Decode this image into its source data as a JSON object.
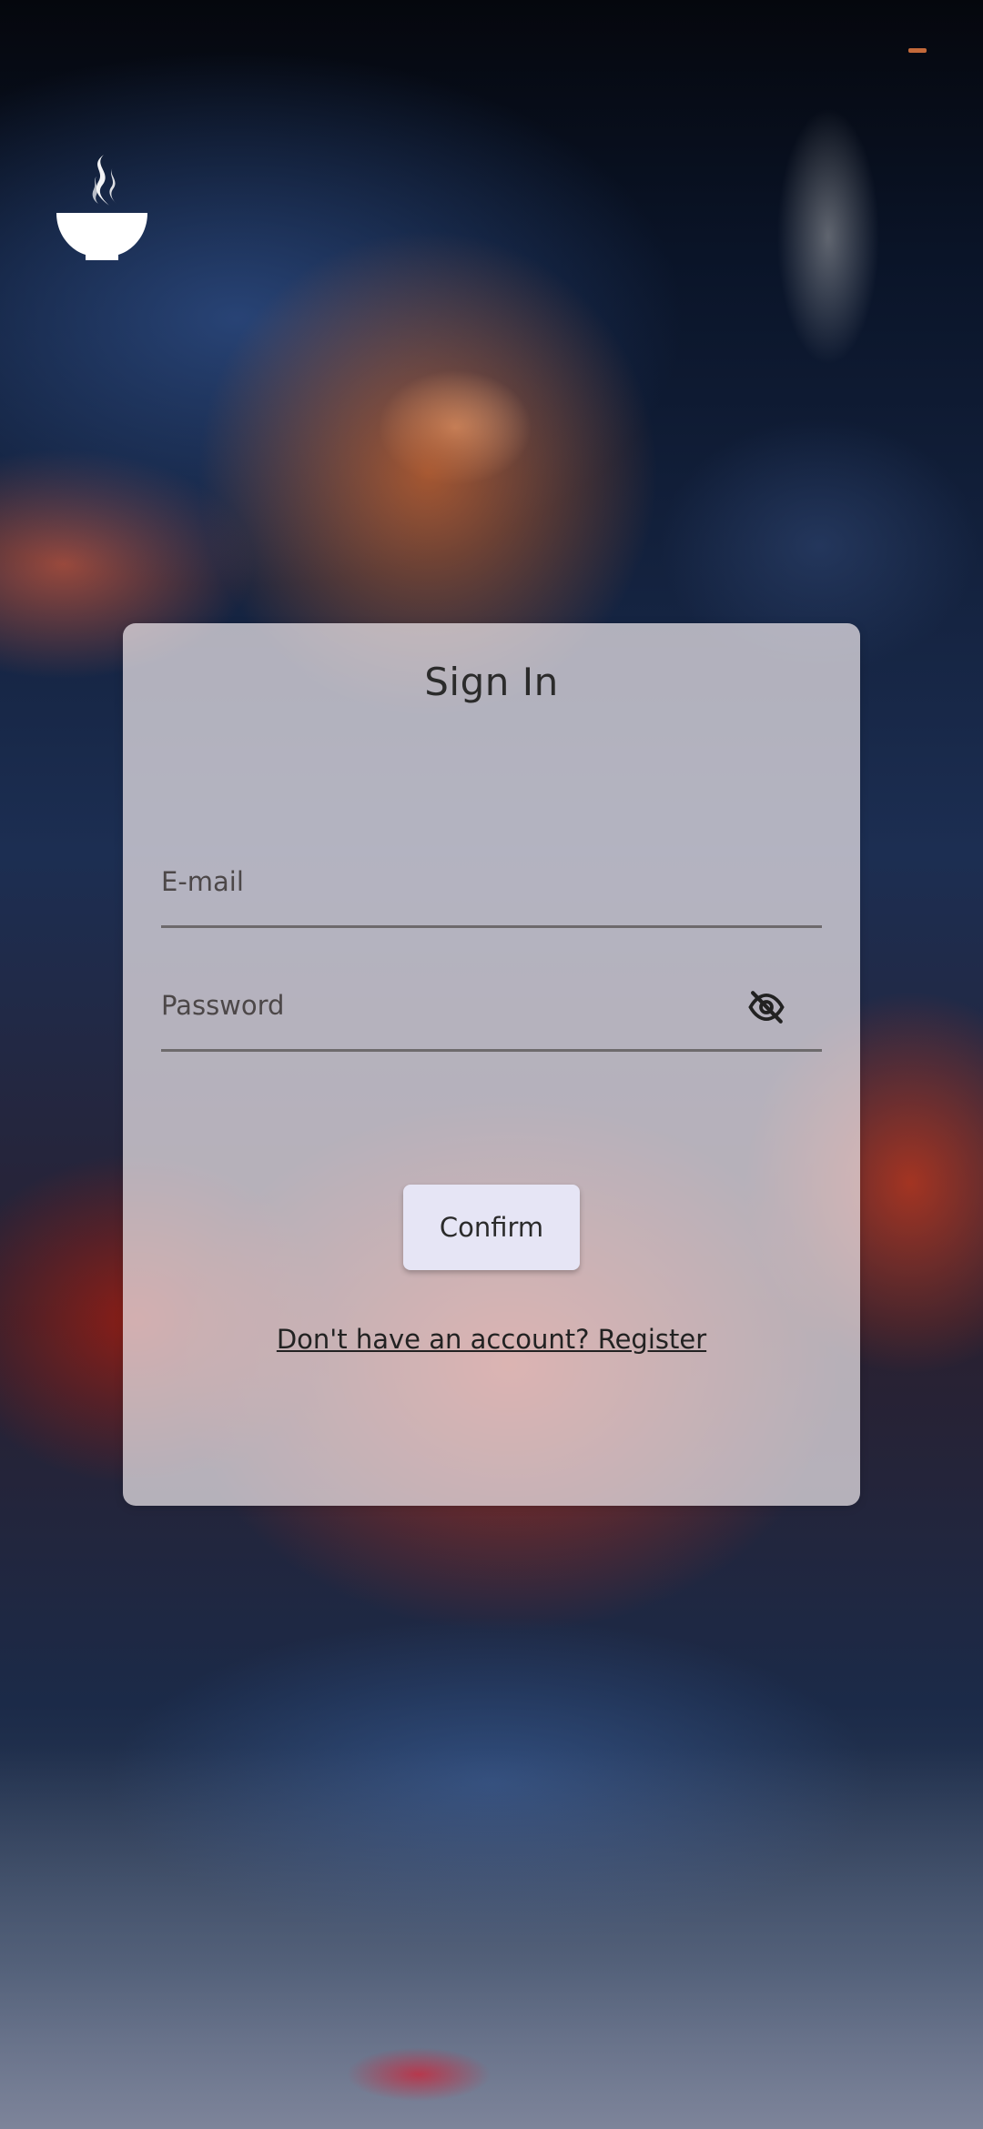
{
  "app": {
    "brand_icon": "steaming-bowl-icon",
    "accent_color": "#c46a3a"
  },
  "sign_in": {
    "title": "Sign In",
    "email": {
      "placeholder": "E-mail",
      "value": ""
    },
    "password": {
      "placeholder": "Password",
      "value": "",
      "toggle_icon": "eye-off-icon"
    },
    "confirm_label": "Confirm",
    "register_link": "Don't have an account? Register"
  }
}
